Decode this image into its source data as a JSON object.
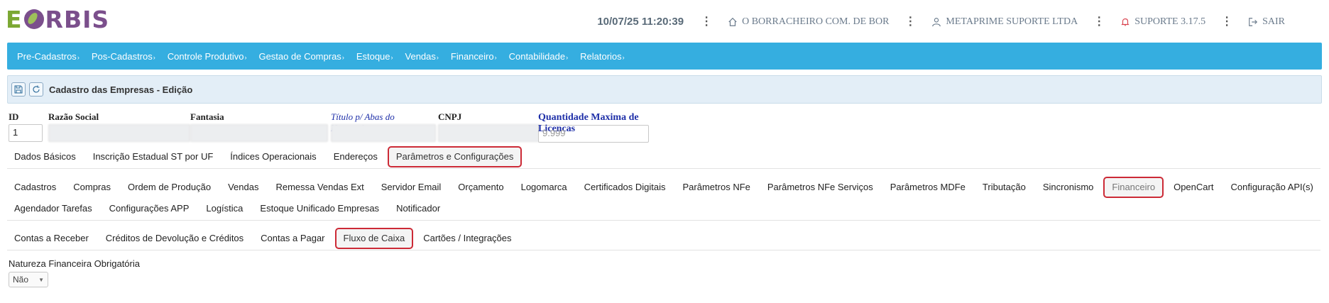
{
  "header": {
    "logo_e": "E",
    "logo_rest": "RBIS",
    "datetime": "10/07/25 11:20:39",
    "store": "O BORRACHEIRO COM. DE BOR",
    "user": "METAPRIME SUPORTE LTDA",
    "support": "SUPORTE 3.17.5",
    "logout": "SAIR",
    "dots": "⋮"
  },
  "nav": {
    "items": [
      {
        "label": "Pre-Cadastros"
      },
      {
        "label": "Pos-Cadastros"
      },
      {
        "label": "Controle Produtivo"
      },
      {
        "label": "Gestao de Compras"
      },
      {
        "label": "Estoque"
      },
      {
        "label": "Vendas"
      },
      {
        "label": "Financeiro"
      },
      {
        "label": "Contabilidade"
      },
      {
        "label": "Relatorios"
      }
    ],
    "chevron": "›"
  },
  "toolbar": {
    "title": "Cadastro das Empresas - Edição"
  },
  "fields": {
    "id": {
      "label": "ID",
      "value": "1"
    },
    "razao": {
      "label": "Razão Social"
    },
    "fantasia": {
      "label": "Fantasia"
    },
    "titulo": {
      "label": "Título p/ Abas do Navegador"
    },
    "cnpj": {
      "label": "CNPJ"
    },
    "licencas": {
      "label": "Quantidade Maxima de Licencas",
      "value": "9.999"
    }
  },
  "tabs_main": [
    {
      "label": "Dados Básicos"
    },
    {
      "label": "Inscrição Estadual ST por UF"
    },
    {
      "label": "Índices Operacionais"
    },
    {
      "label": "Endereços"
    },
    {
      "label": "Parâmetros e Configurações"
    }
  ],
  "tabs_params_row1": [
    {
      "label": "Cadastros"
    },
    {
      "label": "Compras"
    },
    {
      "label": "Ordem de Produção"
    },
    {
      "label": "Vendas"
    },
    {
      "label": "Remessa Vendas Ext"
    },
    {
      "label": "Servidor Email"
    },
    {
      "label": "Orçamento"
    },
    {
      "label": "Logomarca"
    },
    {
      "label": "Certificados Digitais"
    },
    {
      "label": "Parâmetros NFe"
    },
    {
      "label": "Parâmetros NFe Serviços"
    },
    {
      "label": "Parâmetros MDFe"
    },
    {
      "label": "Tributação"
    },
    {
      "label": "Sincronismo"
    },
    {
      "label": "Financeiro"
    },
    {
      "label": "OpenCart"
    },
    {
      "label": "Configuração API(s)"
    }
  ],
  "tabs_params_row2": [
    {
      "label": "Agendador Tarefas"
    },
    {
      "label": "Configurações APP"
    },
    {
      "label": "Logística"
    },
    {
      "label": "Estoque Unificado Empresas"
    },
    {
      "label": "Notificador"
    }
  ],
  "tabs_fin": [
    {
      "label": "Contas a Receber"
    },
    {
      "label": "Créditos de Devolução e Créditos"
    },
    {
      "label": "Contas a Pagar"
    },
    {
      "label": "Fluxo de Caixa"
    },
    {
      "label": "Cartões / Integrações"
    }
  ],
  "natureza": {
    "label": "Natureza Financeira Obrigatória",
    "value": "Não"
  },
  "colors": {
    "nav_bg": "#35aee0",
    "highlight": "#cc2a36",
    "logo_purple": "#7b4f8c",
    "logo_green": "#7ba832"
  }
}
